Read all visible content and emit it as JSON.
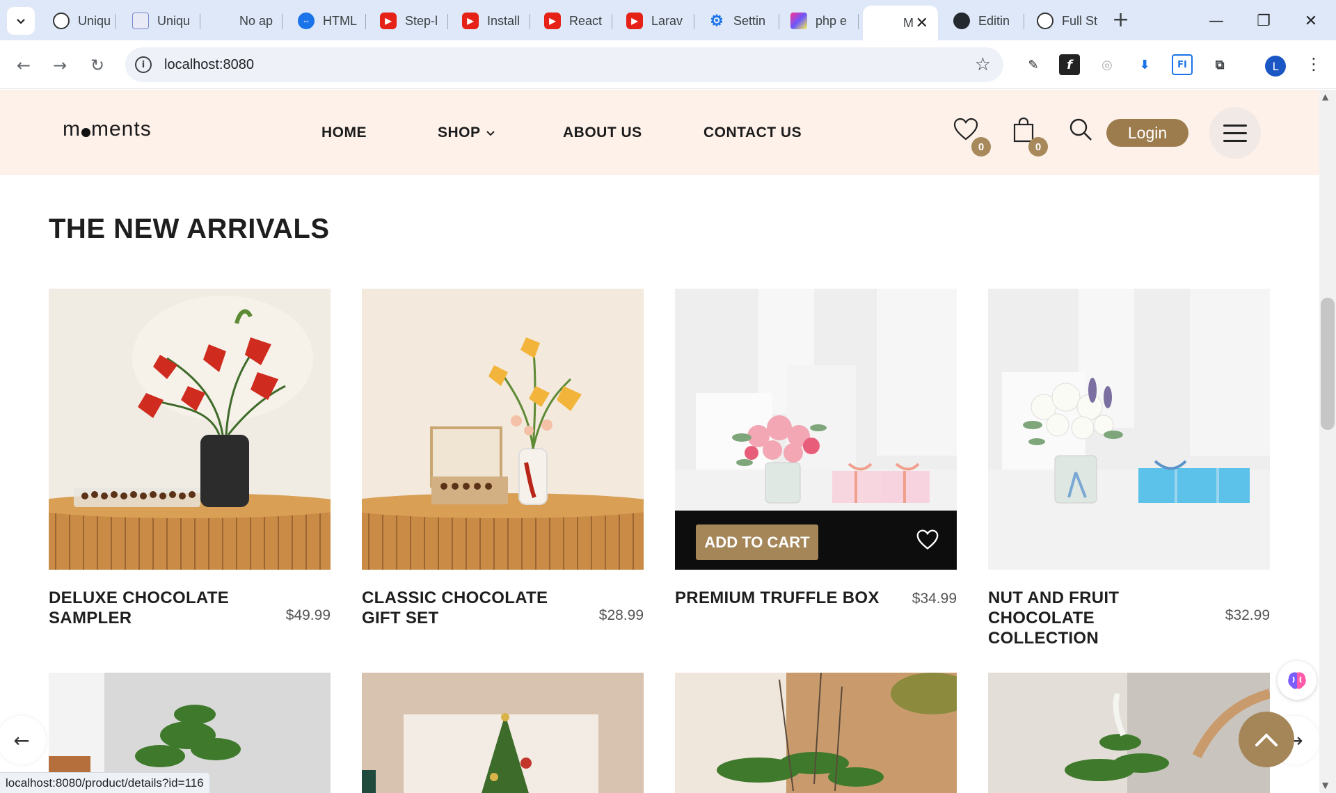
{
  "browser": {
    "tabs": [
      {
        "label": "Uniqu",
        "icon": "chatgpt-icon"
      },
      {
        "label": "Uniqu",
        "icon": "doc-icon"
      },
      {
        "label": "No ap",
        "icon": "blank-page-icon"
      },
      {
        "label": "HTML",
        "icon": "html-icon"
      },
      {
        "label": "Step-l",
        "icon": "youtube-icon"
      },
      {
        "label": "Install",
        "icon": "youtube-icon"
      },
      {
        "label": "React",
        "icon": "youtube-icon"
      },
      {
        "label": "Larav",
        "icon": "youtube-icon"
      },
      {
        "label": "Settin",
        "icon": "gear-icon"
      },
      {
        "label": "php e",
        "icon": "jetbrains-icon"
      },
      {
        "label": "M",
        "icon": "page-icon",
        "active": true
      },
      {
        "label": "Editin",
        "icon": "github-icon"
      },
      {
        "label": "Full St",
        "icon": "chatgpt-icon"
      }
    ],
    "url": "localhost:8080",
    "profile_initial": "L",
    "status_url": "localhost:8080/product/details?id=116"
  },
  "site": {
    "logo": {
      "before": "m",
      "after": "ments"
    },
    "menu": [
      {
        "label": "HOME"
      },
      {
        "label": "SHOP"
      },
      {
        "label": "ABOUT US"
      },
      {
        "label": "CONTACT US"
      }
    ],
    "wishlist_count": "0",
    "cart_count": "0",
    "login_label": "Login"
  },
  "section": {
    "title": "THE NEW ARRIVALS",
    "add_to_cart_label": "ADD TO CART",
    "products": [
      {
        "name": "DELUXE CHOCOLATE SAMPLER",
        "price": "$49.99"
      },
      {
        "name": "CLASSIC CHOCOLATE GIFT SET",
        "price": "$28.99"
      },
      {
        "name": "PREMIUM TRUFFLE BOX",
        "price": "$34.99"
      },
      {
        "name": "NUT AND FRUIT CHOCOLATE COLLECTION",
        "price": "$32.99"
      }
    ]
  },
  "colors": {
    "accent": "#a58658",
    "header_bg": "#fdf1ea",
    "tab_strip": "#dee8f8"
  }
}
